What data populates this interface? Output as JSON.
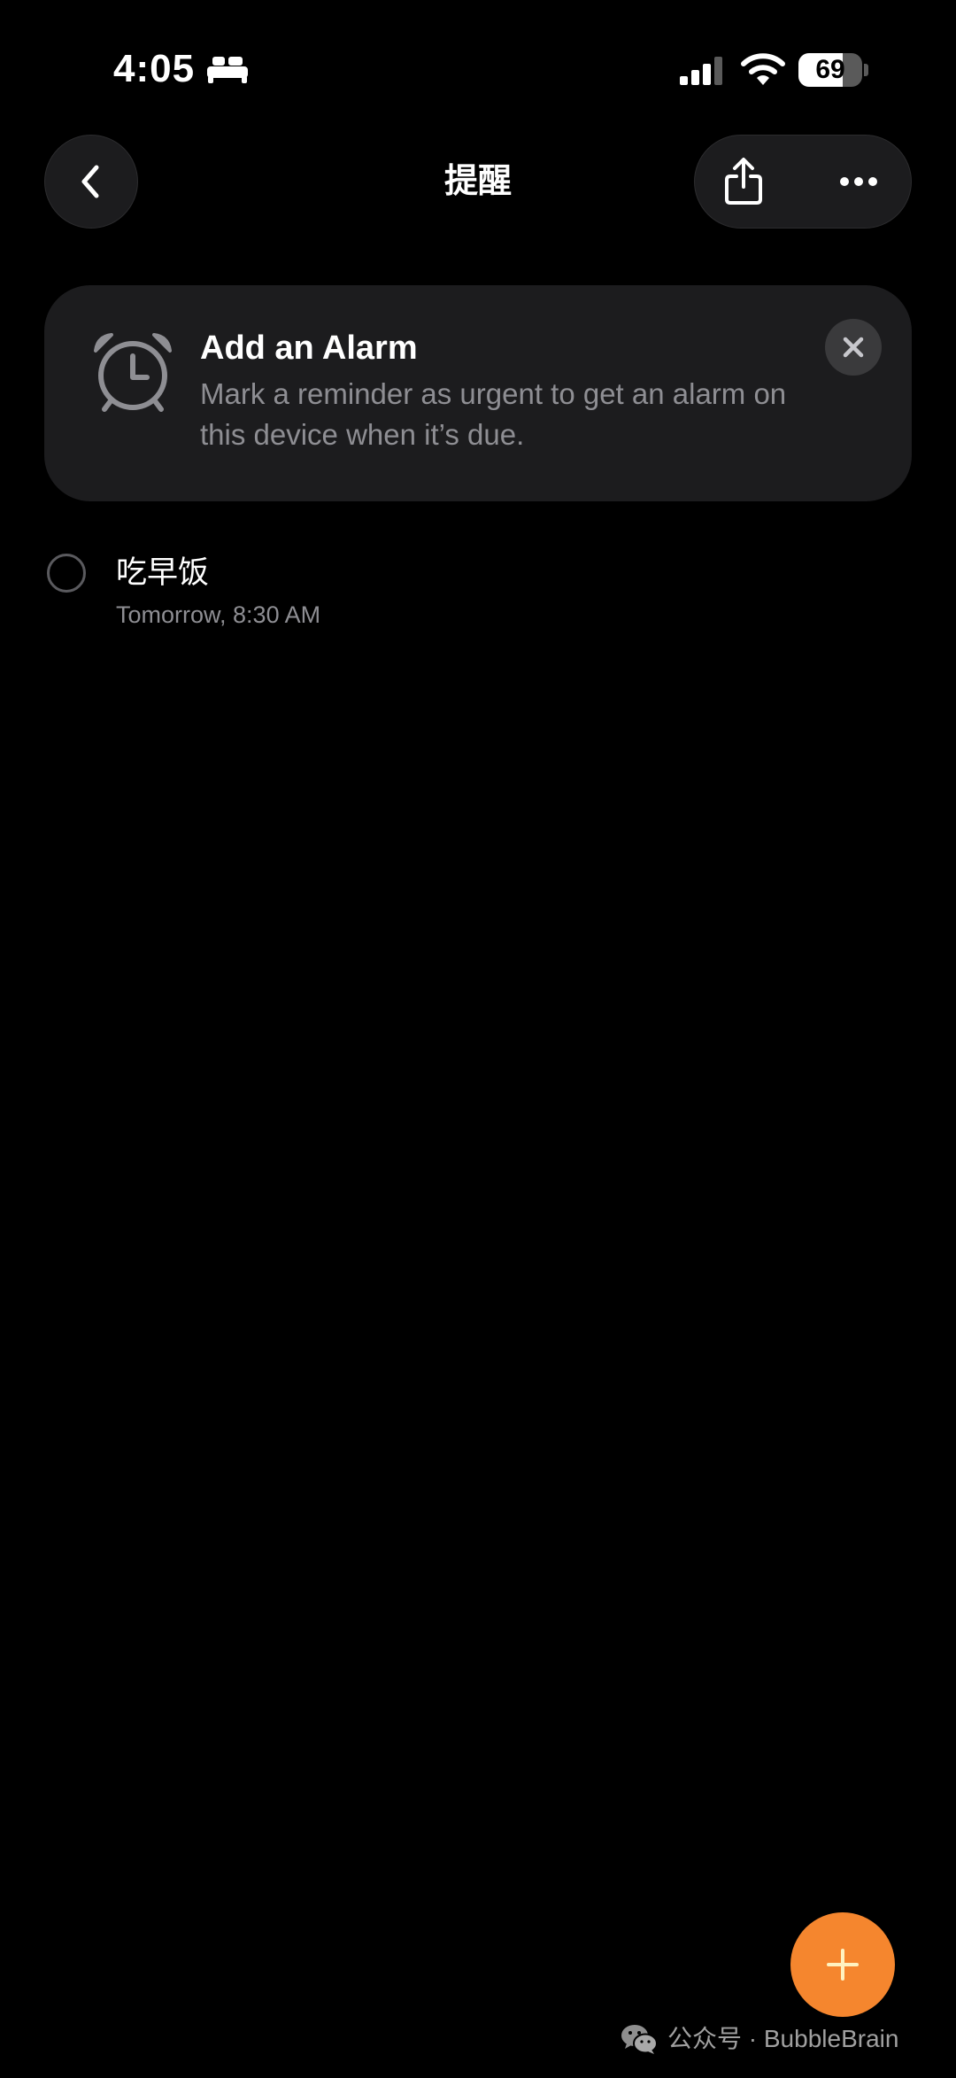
{
  "status_bar": {
    "time": "4:05",
    "battery_level": "69",
    "battery_fraction": 0.69,
    "icons": [
      "sleep-bed-icon",
      "cellular-signal-icon",
      "wifi-icon",
      "battery-icon"
    ]
  },
  "nav": {
    "back_icon": "chevron-left-icon",
    "title": "提醒",
    "share_icon": "share-icon",
    "more_icon": "ellipsis-icon"
  },
  "alarm_banner": {
    "icon": "alarm-clock-icon",
    "title": "Add an Alarm",
    "text": "Mark a reminder as urgent to get an alarm on this device when it’s due.",
    "close_icon": "close-icon"
  },
  "reminders": [
    {
      "title": "吃早饭",
      "date": "Tomorrow, 8:30 AM",
      "completed": false
    }
  ],
  "fab": {
    "icon": "plus-icon",
    "color": "#f5862e"
  },
  "watermark": {
    "icon": "wechat-icon",
    "text": "公众号 · BubbleBrain"
  },
  "colors": {
    "background": "#000000",
    "card": "#1c1c1e",
    "secondary_text": "#8e8e93",
    "accent": "#f5862e"
  }
}
